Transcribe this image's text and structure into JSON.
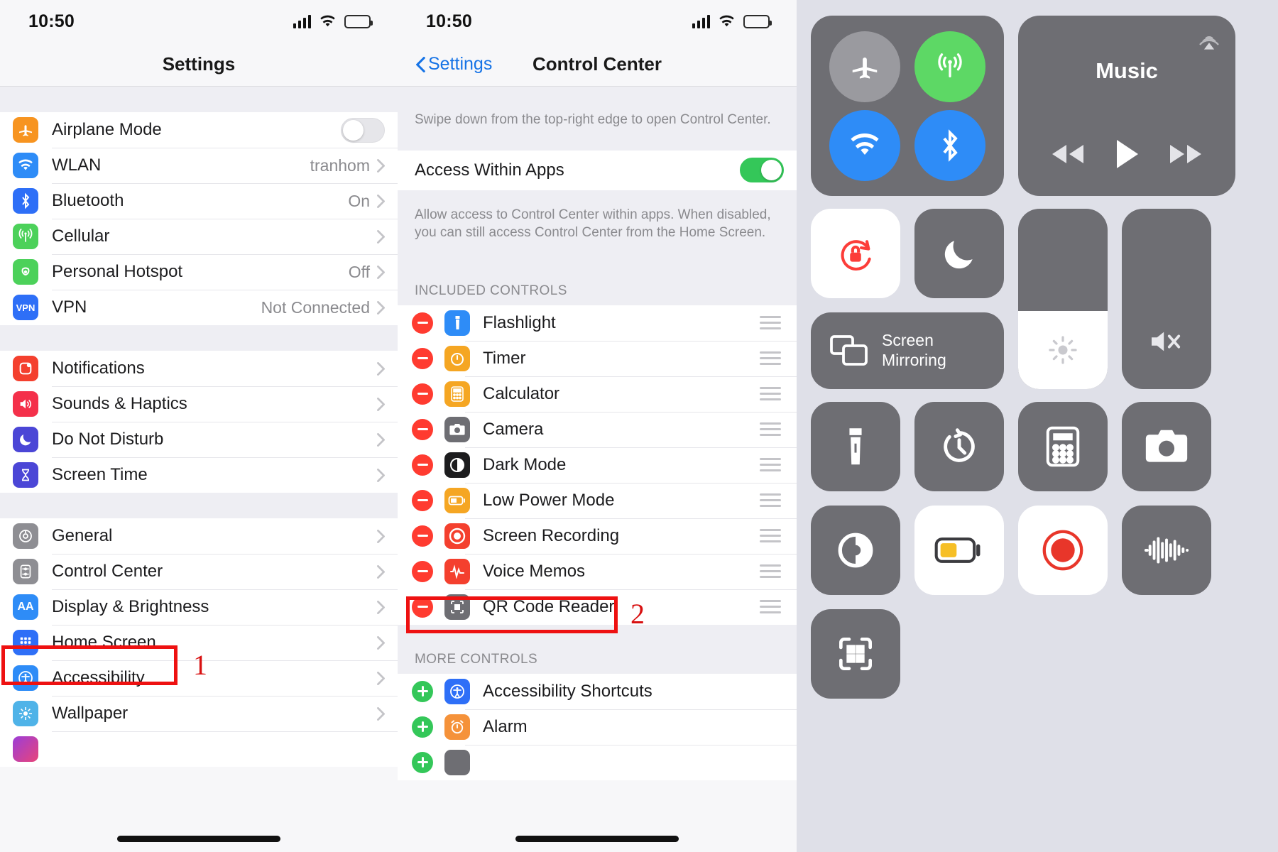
{
  "panel1": {
    "status": {
      "time": "10:50",
      "signal_icon": "cellular-bars-icon",
      "wifi_icon": "wifi-icon",
      "battery_icon": "battery-icon"
    },
    "nav": {
      "title": "Settings"
    },
    "groups": [
      {
        "rows": [
          {
            "label": "Airplane Mode",
            "icon": "airplane-icon",
            "color": "#f79420",
            "control": "toggle",
            "toggle_on": false
          },
          {
            "label": "WLAN",
            "icon": "wifi-icon",
            "color": "#2e8cf7",
            "value": "tranhom",
            "control": "chevron"
          },
          {
            "label": "Bluetooth",
            "icon": "bluetooth-icon",
            "color": "#2e6ff7",
            "value": "On",
            "control": "chevron"
          },
          {
            "label": "Cellular",
            "icon": "cellular-icon",
            "color": "#4cd15a",
            "value": "",
            "control": "chevron"
          },
          {
            "label": "Personal Hotspot",
            "icon": "hotspot-icon",
            "color": "#4cd15a",
            "value": "Off",
            "control": "chevron"
          },
          {
            "label": "VPN",
            "icon": "vpn-icon",
            "color": "#2e6ff7",
            "value": "Not Connected",
            "control": "chevron"
          }
        ]
      },
      {
        "rows": [
          {
            "label": "Notifications",
            "icon": "notifications-icon",
            "color": "#f4402e",
            "value": "",
            "control": "chevron"
          },
          {
            "label": "Sounds & Haptics",
            "icon": "sounds-icon",
            "color": "#f4304a",
            "value": "",
            "control": "chevron"
          },
          {
            "label": "Do Not Disturb",
            "icon": "moon-icon",
            "color": "#4b46d6",
            "value": "",
            "control": "chevron"
          },
          {
            "label": "Screen Time",
            "icon": "hourglass-icon",
            "color": "#4b46d6",
            "value": "",
            "control": "chevron"
          }
        ]
      },
      {
        "rows": [
          {
            "label": "General",
            "icon": "gear-icon",
            "color": "#8e8e93",
            "value": "",
            "control": "chevron"
          },
          {
            "label": "Control Center",
            "icon": "control-center-icon",
            "color": "#8e8e93",
            "value": "",
            "control": "chevron",
            "highlighted": true
          },
          {
            "label": "Display & Brightness",
            "icon": "display-brightness-icon",
            "color": "#2e8cf7",
            "value": "",
            "control": "chevron"
          },
          {
            "label": "Home Screen",
            "icon": "home-screen-icon",
            "color": "#2e6ff7",
            "value": "",
            "control": "chevron"
          },
          {
            "label": "Accessibility",
            "icon": "accessibility-icon",
            "color": "#2e8cf7",
            "value": "",
            "control": "chevron"
          },
          {
            "label": "Wallpaper",
            "icon": "wallpaper-icon",
            "color": "#4fb3e8",
            "value": "",
            "control": "chevron"
          }
        ]
      }
    ],
    "annotation": {
      "number": "1"
    }
  },
  "panel2": {
    "status": {
      "time": "10:50"
    },
    "nav": {
      "back_label": "Settings",
      "title": "Control Center"
    },
    "hint": "Swipe down from the top-right edge to open Control Center.",
    "access_row": {
      "label": "Access Within Apps",
      "toggle_on": true
    },
    "access_desc": "Allow access to Control Center within apps. When disabled, you can still access Control Center from the Home Screen.",
    "included_header": "INCLUDED CONTROLS",
    "included": [
      {
        "label": "Flashlight",
        "icon": "flashlight-icon",
        "color": "#2e8cf7"
      },
      {
        "label": "Timer",
        "icon": "timer-icon",
        "color": "#f5a623"
      },
      {
        "label": "Calculator",
        "icon": "calculator-icon",
        "color": "#f5a623"
      },
      {
        "label": "Camera",
        "icon": "camera-icon",
        "color": "#6e6e73"
      },
      {
        "label": "Dark Mode",
        "icon": "dark-mode-icon",
        "color": "#1c1c1e"
      },
      {
        "label": "Low Power Mode",
        "icon": "low-power-icon",
        "color": "#f5a623"
      },
      {
        "label": "Screen Recording",
        "icon": "record-icon",
        "color": "#f4402e",
        "highlighted": true
      },
      {
        "label": "Voice Memos",
        "icon": "voice-memos-icon",
        "color": "#f4402e"
      },
      {
        "label": "QR Code Reader",
        "icon": "qr-code-icon",
        "color": "#6e6e73"
      }
    ],
    "more_header": "MORE CONTROLS",
    "more": [
      {
        "label": "Accessibility Shortcuts",
        "icon": "accessibility-icon",
        "color": "#2e6ff7"
      },
      {
        "label": "Alarm",
        "icon": "alarm-icon",
        "color": "#f5923a"
      }
    ],
    "annotation": {
      "number": "2"
    }
  },
  "panel3": {
    "connectivity": [
      {
        "name": "airplane-mode-toggle",
        "icon": "airplane-icon",
        "state": "off",
        "color": "#9a9a9f"
      },
      {
        "name": "cellular-toggle",
        "icon": "cellular-icon",
        "state": "on",
        "color": "#5dd865"
      },
      {
        "name": "wifi-toggle",
        "icon": "wifi-icon",
        "state": "on",
        "color": "#2e8cf7"
      },
      {
        "name": "bluetooth-toggle",
        "icon": "bluetooth-icon",
        "state": "on",
        "color": "#2e8cf7"
      }
    ],
    "media": {
      "title": "Music",
      "airplay_icon": "airplay-icon",
      "prev_icon": "rewind-icon",
      "play_icon": "play-icon",
      "next_icon": "fastforward-icon"
    },
    "rotation_lock": {
      "icon": "rotation-lock-icon",
      "state": "on",
      "color": "#ff3b30"
    },
    "do_not_disturb": {
      "icon": "moon-icon",
      "state": "off"
    },
    "screen_mirroring": {
      "label_line1": "Screen",
      "label_line2": "Mirroring",
      "icon": "screen-mirroring-icon"
    },
    "brightness_slider": {
      "icon": "brightness-icon",
      "level_percent": 43
    },
    "volume_slider": {
      "icon": "mute-icon",
      "level_percent": 0
    },
    "tiles": [
      {
        "name": "flashlight-tile",
        "icon": "flashlight-icon",
        "state": "off"
      },
      {
        "name": "timer-tile",
        "icon": "timer-icon",
        "state": "off"
      },
      {
        "name": "calculator-tile",
        "icon": "calculator-icon",
        "state": "off"
      },
      {
        "name": "camera-tile",
        "icon": "camera-icon",
        "state": "off"
      },
      {
        "name": "dark-mode-tile",
        "icon": "dark-mode-icon",
        "state": "off"
      },
      {
        "name": "low-power-mode-tile",
        "icon": "low-power-icon",
        "state": "on"
      },
      {
        "name": "screen-recording-tile",
        "icon": "record-icon",
        "state": "on"
      },
      {
        "name": "voice-memos-tile",
        "icon": "voice-memos-icon",
        "state": "off"
      },
      {
        "name": "qr-code-reader-tile",
        "icon": "qr-code-icon",
        "state": "off"
      }
    ]
  },
  "colors": {
    "accent_red": "#ee1111",
    "green": "#34c759",
    "blue": "#1673e6"
  }
}
